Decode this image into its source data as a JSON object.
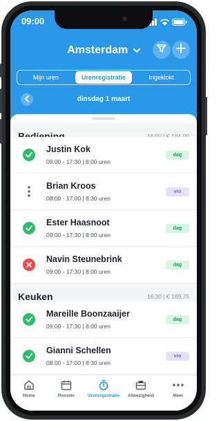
{
  "status_bar": {
    "time": "09:00"
  },
  "header": {
    "city": "Amsterdam",
    "tabs": [
      {
        "label": "Mijn uren",
        "active": false
      },
      {
        "label": "Urenregistratie",
        "active": true
      },
      {
        "label": "Ingeklokt",
        "active": false
      }
    ],
    "date": "dinsdag 1 maart"
  },
  "sections": [
    {
      "title": "Bediening",
      "meta": "16:00 | € 184,00",
      "rows": [
        {
          "name": "Justin Kok",
          "times": "09:00 - 17:30 | 8:00 uren",
          "status": "ok",
          "tag": "dag"
        },
        {
          "name": "Brian Kroos",
          "times": "08:00 - 17:00 | 8:30 uren",
          "status": "menu",
          "tag": "vro"
        },
        {
          "name": "Ester Haasnoot",
          "times": "09:00 - 17:30 | 8:00 uren",
          "status": "ok",
          "tag": "dag"
        },
        {
          "name": "Navin Steunebrink",
          "times": "09:00 - 17:30 | 8:00 uren",
          "status": "rejected",
          "tag": "dag"
        }
      ]
    },
    {
      "title": "Keuken",
      "meta": "16:30 | € 189,75",
      "rows": [
        {
          "name": "Mareille Boonzaaijer",
          "times": "09:00 - 17:30 | 8:00 uren",
          "status": "ok",
          "tag": "dag"
        },
        {
          "name": "Gianni Schellen",
          "times": "08:00 - 17:00 | 8:30 uren",
          "status": "ok",
          "tag": "vro"
        }
      ]
    }
  ],
  "tabbar": [
    {
      "label": "Home",
      "icon": "home-icon"
    },
    {
      "label": "Rooster",
      "icon": "calendar-icon"
    },
    {
      "label": "Urenregistratie",
      "icon": "stopwatch-icon",
      "active": true
    },
    {
      "label": "Afwezigheid",
      "icon": "briefcase-icon"
    },
    {
      "label": "Meer",
      "icon": "more-icon"
    }
  ],
  "colors": {
    "brand": "#2a98e8",
    "ok": "#2bbf6a",
    "rejected": "#f0474f",
    "tag_dag": "#d6f5e4",
    "tag_vro": "#e7e1f7"
  }
}
